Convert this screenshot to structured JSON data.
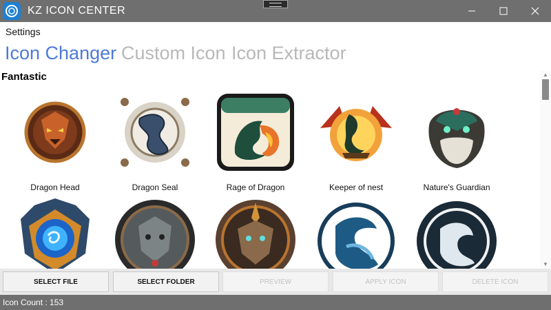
{
  "window": {
    "title": "KZ ICON CENTER",
    "controls": [
      "minimize-icon",
      "maximize-icon",
      "close-icon"
    ]
  },
  "menu": {
    "settings": "Settings"
  },
  "tabs": [
    {
      "label": "Icon Changer",
      "active": true
    },
    {
      "label": "Custom Icon",
      "active": false
    },
    {
      "label": "Icon Extractor",
      "active": false
    }
  ],
  "section": {
    "title": "Fantastic"
  },
  "icons": [
    {
      "label": "Dragon Head",
      "icon": "dragon-head-icon"
    },
    {
      "label": "Dragon Seal",
      "icon": "dragon-seal-icon"
    },
    {
      "label": "Rage of Dragon",
      "icon": "rage-of-dragon-icon"
    },
    {
      "label": "Keeper of nest",
      "icon": "keeper-of-nest-icon"
    },
    {
      "label": "Nature's Guardian",
      "icon": "natures-guardian-icon"
    },
    {
      "label": "",
      "icon": "blue-orb-emblem-icon"
    },
    {
      "label": "",
      "icon": "stone-demon-emblem-icon"
    },
    {
      "label": "",
      "icon": "bronze-warrior-emblem-icon"
    },
    {
      "label": "",
      "icon": "blue-dragon-circle-icon"
    },
    {
      "label": "",
      "icon": "dark-dragon-circle-icon"
    }
  ],
  "buttons": {
    "select_file": "SELECT FILE",
    "select_folder": "SELECT FOLDER",
    "preview": "PREVIEW",
    "apply_icon": "APPLY ICON",
    "delete_icon": "DELETE ICON"
  },
  "status": {
    "text": "Icon Count : 153"
  },
  "colors": {
    "titlebar": "#6f6f6f",
    "active_tab": "#4d7ad8",
    "inactive_tab": "#b8b8b8",
    "toolbar": "#e8e8e8"
  }
}
